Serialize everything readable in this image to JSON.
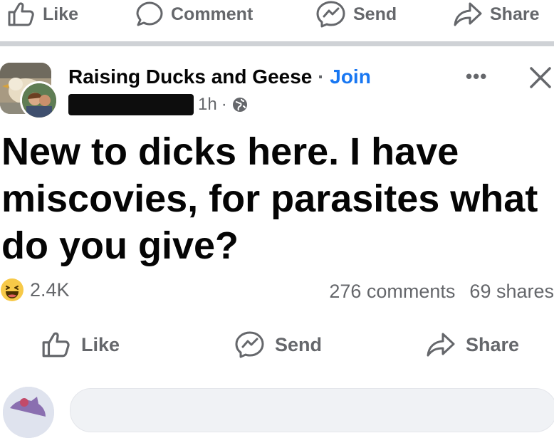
{
  "top_actions": {
    "like": "Like",
    "comment": "Comment",
    "send": "Send",
    "share": "Share"
  },
  "post": {
    "group_name": "Raising Ducks and Geese",
    "separator": "·",
    "join_label": "Join",
    "time": "1h",
    "meta_separator": "·",
    "more_label": "•••",
    "text": "New to dicks here. I have miscovies, for parasites what do you give?",
    "reaction_count": "2.4K",
    "comments_count": "276 comments",
    "shares_count": "69 shares"
  },
  "bottom_actions": {
    "like": "Like",
    "send": "Send",
    "share": "Share"
  },
  "colors": {
    "accent": "#1877f2",
    "muted": "#65676b",
    "divider": "#cfd2d6"
  }
}
